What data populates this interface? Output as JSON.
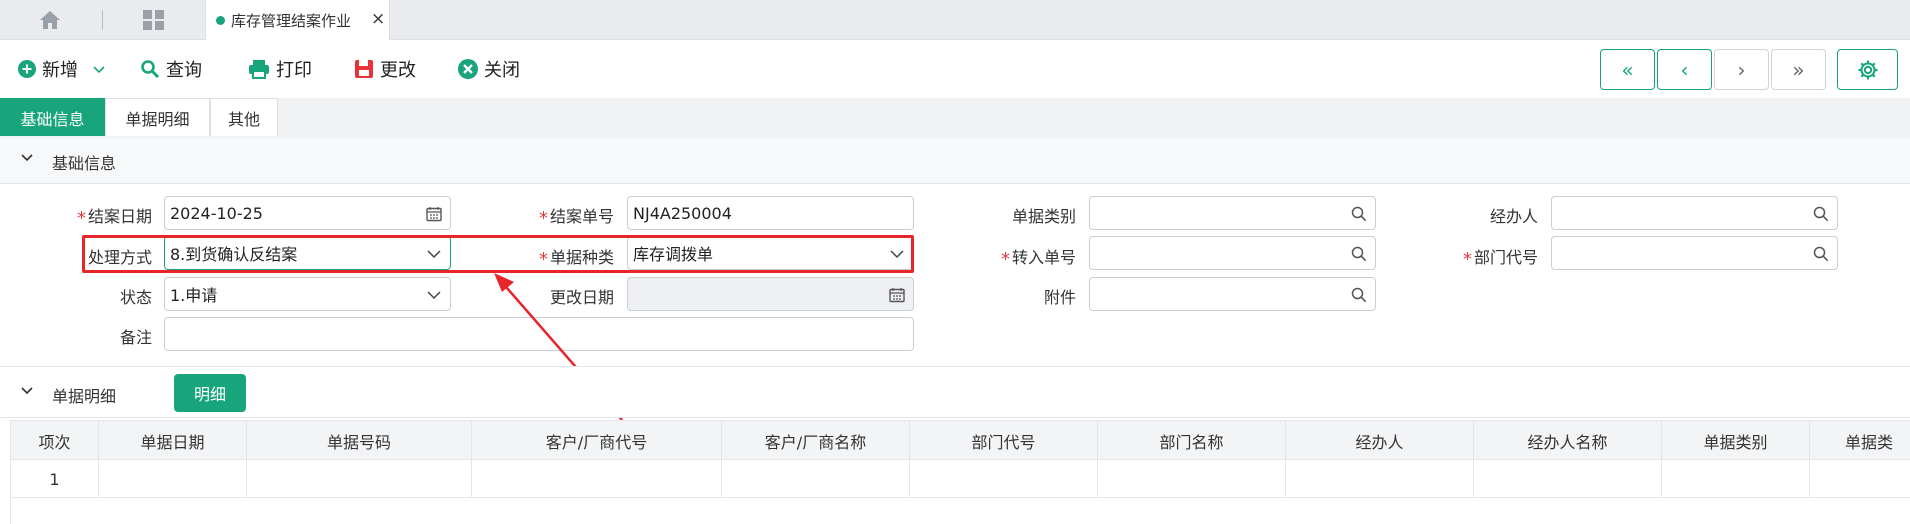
{
  "tabbar": {
    "active_tab": "库存管理结案作业",
    "close": "×"
  },
  "toolbar": {
    "new": "新增",
    "query": "查询",
    "print": "打印",
    "edit": "更改",
    "close": "关闭",
    "nav": {
      "first": "«",
      "prev": "‹",
      "next": "›",
      "last": "»"
    }
  },
  "subtabs": [
    "基础信息",
    "单据明细",
    "其他"
  ],
  "basic_section": {
    "title": "基础信息"
  },
  "form": {
    "close_date_label": "结案日期",
    "close_date_value": "2024-10-25",
    "close_no_label": "结案单号",
    "close_no_value": "NJ4A250004",
    "doc_category_label": "单据类别",
    "doc_category_value": "",
    "handler_label": "经办人",
    "handler_value": "",
    "process_label": "处理方式",
    "process_value": "8.到货确认反结案",
    "doc_kind_label": "单据种类",
    "doc_kind_value": "库存调拨单",
    "transfer_no_label": "转入单号",
    "transfer_no_value": "",
    "dept_code_label": "部门代号",
    "dept_code_value": "",
    "status_label": "状态",
    "status_value": "1.申请",
    "modify_date_label": "更改日期",
    "modify_date_value": "",
    "attachment_label": "附件",
    "attachment_value": "",
    "remark_label": "备注",
    "remark_value": "",
    "required_mark": "*"
  },
  "detail_section": {
    "title": "单据明细",
    "button": "明细"
  },
  "table": {
    "columns": [
      "项次",
      "单据日期",
      "单据号码",
      "客户/厂商代号",
      "客户/厂商名称",
      "部门代号",
      "部门名称",
      "经办人",
      "经办人名称",
      "单据类别",
      "单据类"
    ],
    "rows": [
      [
        "1",
        "",
        "",
        "",
        "",
        "",
        "",
        "",
        "",
        "",
        ""
      ]
    ]
  },
  "colors": {
    "accent": "#18a57c",
    "callout": "#e8262a",
    "required": "#e03b3b"
  },
  "icons": [
    "home-icon",
    "apps-grid-icon",
    "plus-circle-icon",
    "chevron-down-icon",
    "search-icon",
    "printer-icon",
    "save-icon",
    "close-circle-icon",
    "gear-icon",
    "calendar-icon"
  ]
}
